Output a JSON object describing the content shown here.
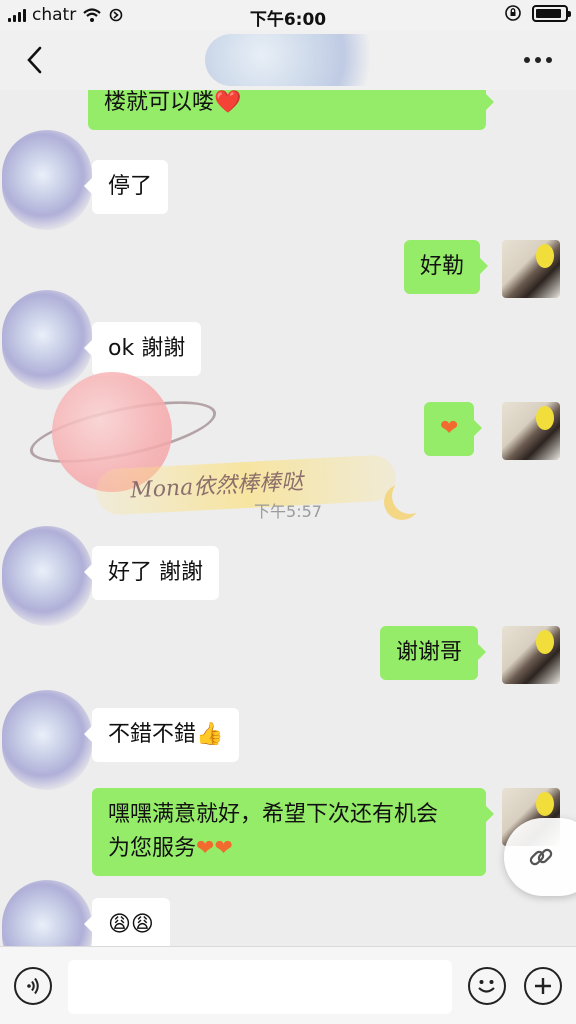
{
  "status_bar": {
    "carrier": "chatr",
    "time": "下午6:00"
  },
  "messages": [
    {
      "side": "out",
      "text": "楼就可以喽",
      "suffix": "❤️"
    },
    {
      "side": "in",
      "text": "停了"
    },
    {
      "side": "out",
      "text": "好勒"
    },
    {
      "side": "in",
      "text": "ok 謝謝"
    },
    {
      "side": "out",
      "text": "",
      "suffix": "❤"
    },
    {
      "side": "in",
      "text": "好了 謝謝"
    },
    {
      "side": "out",
      "text": "谢谢哥"
    },
    {
      "side": "in",
      "text": "不錯不錯",
      "suffix": "👍"
    },
    {
      "side": "out",
      "text": "嘿嘿满意就好，希望下次还有机会",
      "text2": "为您服务",
      "suffix": "❤❤"
    },
    {
      "side": "in",
      "text": "",
      "suffix": "😩😩"
    }
  ],
  "timestamp": "下午5:57",
  "watermark": "Mona依然棒棒哒",
  "icons": {
    "back": "chevron-left-icon",
    "more": "more-dots-icon",
    "voice": "voice-icon",
    "emoji": "emoji-icon",
    "plus": "plus-icon",
    "link": "link-icon"
  },
  "colors": {
    "outgoing_bubble": "#95ec69",
    "incoming_bubble": "#ffffff",
    "background": "#ededed"
  }
}
